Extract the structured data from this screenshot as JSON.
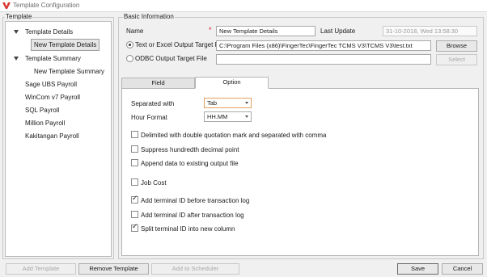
{
  "window": {
    "title": "Template Configuration"
  },
  "template_panel": {
    "group_label": "Template",
    "items": [
      {
        "label": "Template Details",
        "level": 0,
        "expanded": true
      },
      {
        "label": "New Template Details",
        "level": 1,
        "selected": true
      },
      {
        "label": "Template Summary",
        "level": 0,
        "expanded": true
      },
      {
        "label": "New Template Summary",
        "level": 1
      },
      {
        "label": "Sage UBS Payroll",
        "level": 0
      },
      {
        "label": "WinCom v7 Payroll",
        "level": 0
      },
      {
        "label": "SQL Payroll",
        "level": 0
      },
      {
        "label": "Million Payroll",
        "level": 0
      },
      {
        "label": "Kakitangan Payroll",
        "level": 0
      }
    ]
  },
  "basic_info": {
    "group_label": "Basic Information",
    "name_label": "Name",
    "required_mark": "*",
    "name_value": "New Template Details",
    "last_update_label": "Last Update",
    "last_update_value": "31-10-2018, Wed  13:58:30",
    "text_excel_label": "Text or Excel Output Target File",
    "text_excel_path": "C:\\Program Files (x86)\\FingerTec\\FingerTec TCMS V3\\TCMS V3\\test.txt",
    "browse_label": "Browse",
    "odbc_label": "ODBC Output Target File",
    "odbc_value": "",
    "select_label": "Select"
  },
  "tabs": [
    {
      "label": "Field",
      "active": false
    },
    {
      "label": "Option",
      "active": true
    }
  ],
  "options": {
    "separated_with_label": "Separated with",
    "separated_with_value": "Tab",
    "hour_format_label": "Hour Format",
    "hour_format_value": "HH.MM",
    "checkboxes": [
      {
        "label": "Delimited with double quotation mark and separated with comma",
        "checked": false
      },
      {
        "label": "Suppress hundredth decimal point",
        "checked": false
      },
      {
        "label": "Append data to existing output file",
        "checked": false
      },
      {
        "label": "Job Cost",
        "checked": false
      },
      {
        "label": "Add terminal ID before transaction log",
        "checked": true
      },
      {
        "label": "Add terminal ID after transaction log",
        "checked": false
      },
      {
        "label": "Split terminal ID into new column",
        "checked": true
      }
    ]
  },
  "footer": {
    "add_template": "Add Template",
    "remove_template": "Remove Template",
    "add_to_scheduler": "Add to Scheduler",
    "save": "Save",
    "cancel": "Cancel"
  },
  "colors": {
    "logo": "#d9332b",
    "required": "#e02020",
    "select_focus_border": "#e0a060"
  }
}
